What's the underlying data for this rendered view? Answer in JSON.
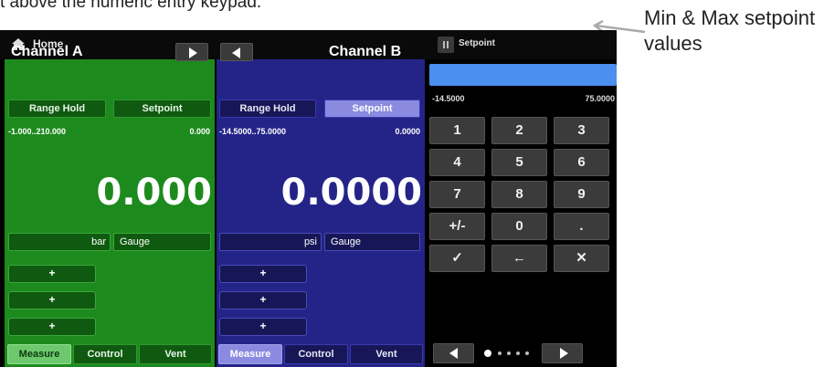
{
  "caption": "t above the numeric entry keypad.",
  "annotation": "Min & Max setpoint values",
  "titlebar": {
    "home_label": "Home",
    "setpoint_label": "Setpoint"
  },
  "channel_a": {
    "title": "Channel A",
    "range_hold_label": "Range Hold",
    "setpoint_label": "Setpoint",
    "range": "-1.000..210.000",
    "setpoint_value": "0.000",
    "reading": "0.000",
    "unit": "bar",
    "mode": "Gauge",
    "plus_buttons": [
      "+",
      "+",
      "+"
    ]
  },
  "channel_b": {
    "title": "Channel B",
    "range_hold_label": "Range Hold",
    "setpoint_label": "Setpoint",
    "range": "-14.5000..75.0000",
    "setpoint_value": "0.0000",
    "reading": "0.0000",
    "unit": "psi",
    "mode": "Gauge",
    "plus_buttons": [
      "+",
      "+",
      "+"
    ]
  },
  "tabs": {
    "measure": "Measure",
    "control": "Control",
    "vent": "Vent"
  },
  "setpoint_panel": {
    "entry_value": "",
    "min_value": "-14.5000",
    "max_value": "75.0000",
    "keys": [
      "1",
      "2",
      "3",
      "4",
      "5",
      "6",
      "7",
      "8",
      "9",
      "+/-",
      "0",
      ".",
      "✓",
      "←",
      "✕"
    ]
  },
  "pager": {
    "page_count": 5,
    "current_page": 1
  },
  "colors": {
    "channel_a_bg": "#1d8a1d",
    "channel_b_bg": "#242488",
    "entry_field": "#4b8ff0",
    "active_tab": "#6ec96e"
  }
}
